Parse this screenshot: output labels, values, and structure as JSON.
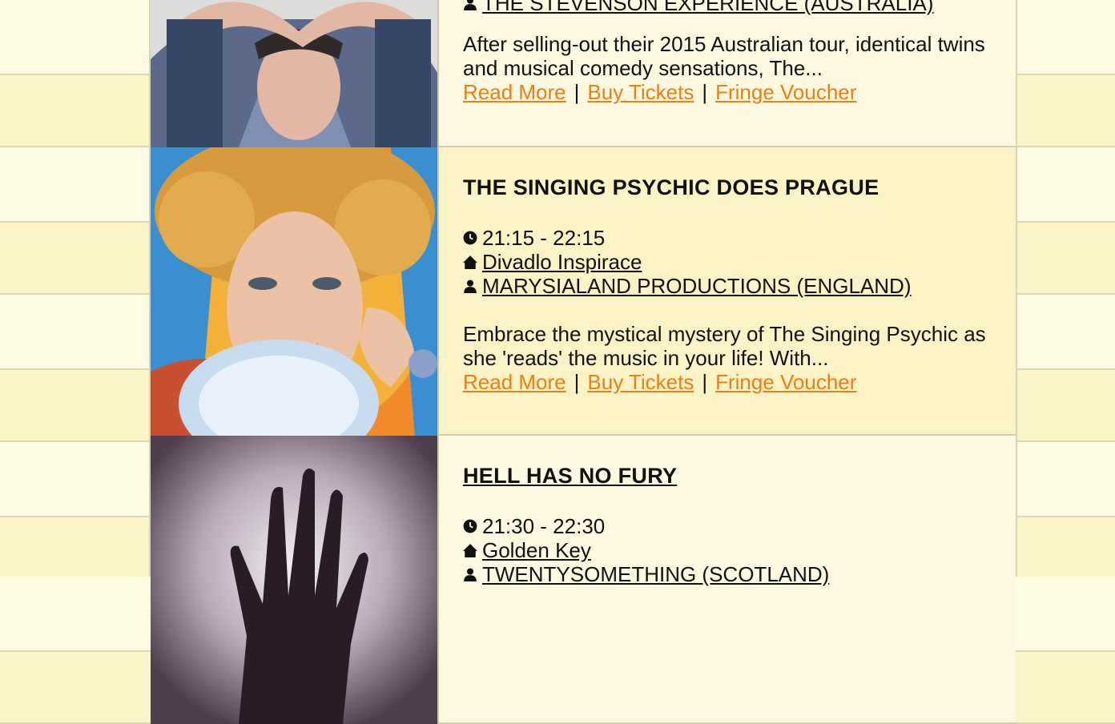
{
  "shows": [
    {
      "title": "THE STEVENSON EXPERIENCE (AUSTRALIA)",
      "company": "THE STEVENSON EXPERIENCE (AUSTRALIA)",
      "description": "After selling-out their 2015 Australian tour, identical twins and musical comedy sensations, The...",
      "read_more": "Read More",
      "buy_tickets": "Buy Tickets",
      "fringe_voucher": "Fringe Voucher"
    },
    {
      "title": "THE SINGING PSYCHIC DOES PRAGUE",
      "time": "21:15 - 22:15",
      "venue": "Divadlo Inspirace",
      "company": "MARYSIALAND PRODUCTIONS (ENGLAND)",
      "description": "Embrace the mystical mystery of The Singing Psychic as she 'reads' the music in your life!  With...",
      "read_more": "Read More",
      "buy_tickets": "Buy Tickets",
      "fringe_voucher": "Fringe Voucher"
    },
    {
      "title": "HELL HAS NO FURY",
      "time": "21:30 - 22:30",
      "venue": "Golden Key",
      "company": "TWENTYSOMETHING (SCOTLAND)"
    }
  ],
  "separator": "|",
  "colors": {
    "link": "#f07d10",
    "row_light": "#fdf9e1",
    "row_yellow": "#fbf2c6"
  }
}
